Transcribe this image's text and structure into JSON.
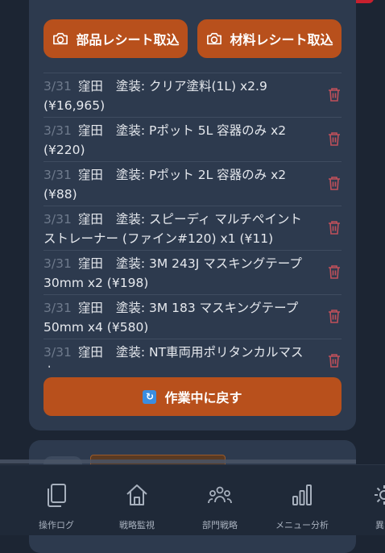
{
  "card": {
    "parts_receipt_label": "部品レシート取込",
    "material_receipt_label": "材料レシート取込",
    "back_button_label": "作業中に戻す",
    "items": [
      {
        "date": "3/31",
        "person": "窪田",
        "desc": "塗装: クリア塗料(1L) x2.9 (¥16,965)"
      },
      {
        "date": "3/31",
        "person": "窪田",
        "desc": "塗装: Pポット 5L 容器のみ x2 (¥220)"
      },
      {
        "date": "3/31",
        "person": "窪田",
        "desc": "塗装: Pポット 2L 容器のみ x2 (¥88)"
      },
      {
        "date": "3/31",
        "person": "窪田",
        "desc": "塗装: スピーディ マルチペイントストレーナー (ファイン#120) x1 (¥11)"
      },
      {
        "date": "3/31",
        "person": "窪田",
        "desc": "塗装: 3M 243J マスキングテープ 30mm x2 (¥198)"
      },
      {
        "date": "3/31",
        "person": "窪田",
        "desc": "塗装: 3M 183 マスキングテープ 50mm x4 (¥580)"
      },
      {
        "date": "3/31",
        "person": "窪田",
        "desc": "塗装: NT車両用ポリタンカルマスカ"
      }
    ]
  },
  "nav": {
    "items": [
      {
        "label": "操作ログ",
        "icon": "copy-icon"
      },
      {
        "label": "戦略監視",
        "icon": "home-icon"
      },
      {
        "label": "部門戦略",
        "icon": "people-icon"
      },
      {
        "label": "メニュー分析",
        "icon": "bar-chart-icon"
      },
      {
        "label": "異常",
        "icon": "gear-icon"
      }
    ]
  },
  "colors": {
    "accent": "#b8501c",
    "background": "#1c2533",
    "card": "#2d3a4e",
    "trash": "#c0505a"
  }
}
